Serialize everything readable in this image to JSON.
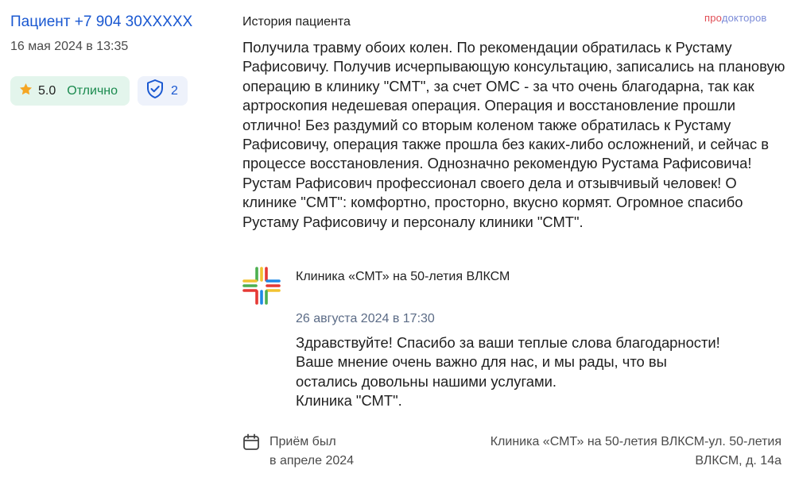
{
  "author": {
    "name": "Пациент +7 904 30XXXXX",
    "date": "16 мая 2024 в 13:35"
  },
  "rating": {
    "icon": "star-icon",
    "value": "5.0",
    "label": "Отлично",
    "star_color": "#f5a623",
    "label_color": "#1a8a4e"
  },
  "verification": {
    "icon": "shield-check-icon",
    "count": "2"
  },
  "section_title": "История пациента",
  "brand": {
    "prefix": "про",
    "suffix": "докторов"
  },
  "review_text": "Получила травму обоих колен. По рекомендации обратилась к Рустаму Рафисовичу. Получив исчерпывающую консультацию, записались на плановую операцию в клинику \"СМТ\", за счет ОМС - за что очень благодарна, так как артроскопия недешевая операция. Операция и восстановление прошли отлично! Без раздумий со вторым коленом также обратилась к Рустаму Рафисовичу, операция также прошла без каких-либо осложнений, и сейчас в процессе восстановления. Однозначно рекомендую Рустама Рафисовича! Рустам Рафисович профессионал своего дела и отзывчивый человек! О клинике \"СМТ\": комфортно, просторно, вкусно кормят. Огромное спасибо Рустаму Рафисовичу и персоналу клиники \"СМТ\".",
  "clinic_reply": {
    "clinic_name": "Клиника «СМТ» на 50-летия ВЛКСМ",
    "date": "26 августа 2024 в 17:30",
    "lines": [
      "Здравствуйте! Спасибо за ваши теплые слова благодарности!",
      "Ваше мнение очень важно для нас, и мы рады, что вы",
      "остались довольны нашими услугами.",
      "Клиника \"СМТ\"."
    ]
  },
  "footer": {
    "calendar_icon": "calendar-icon",
    "visit_line1": "Приём был",
    "visit_line2": "в апреле 2024",
    "address_line1": "Клиника «СМТ» на 50-летия ВЛКСМ-ул. 50-летия",
    "address_line2": "ВЛКСМ, д. 14а"
  }
}
